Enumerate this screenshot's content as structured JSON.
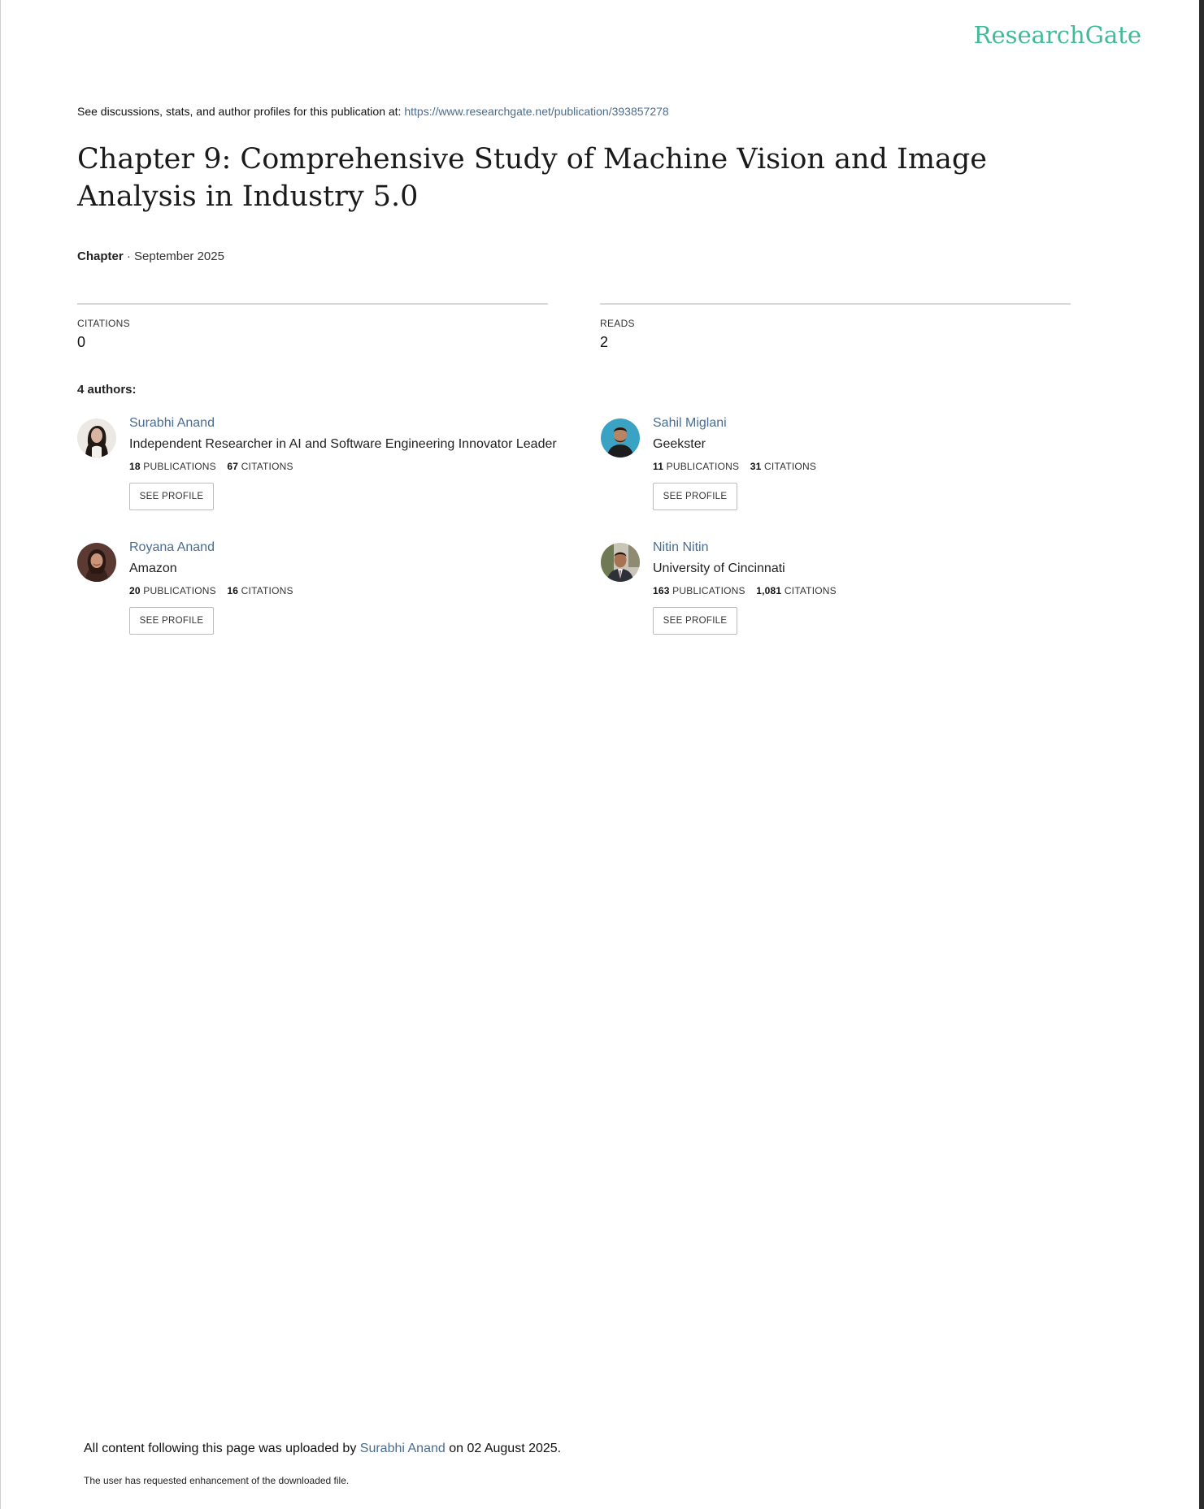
{
  "brand": {
    "logo_text": "ResearchGate",
    "logo_color": "#40ba9b",
    "link_color": "#4a6d8f"
  },
  "source": {
    "prefix": "See discussions, stats, and author profiles for this publication at:",
    "url": "https://www.researchgate.net/publication/393857278"
  },
  "publication": {
    "title": "Chapter 9: Comprehensive Study of Machine Vision and Image Analysis in Industry 5.0",
    "type": "Chapter",
    "separator": " · ",
    "date": "September 2025"
  },
  "stats": {
    "citations_label": "CITATIONS",
    "citations_value": "0",
    "reads_label": "READS",
    "reads_value": "2"
  },
  "authors_heading": "4 authors:",
  "authors": [
    {
      "name": "Surabhi Anand",
      "affiliation": "Independent Researcher in AI and Software Engineering Innovator Leader",
      "publications": "18",
      "citations": "67",
      "avatar": "portrait-woman-light-bg-icon"
    },
    {
      "name": "Sahil Miglani",
      "affiliation": "Geekster",
      "publications": "11",
      "citations": "31",
      "avatar": "portrait-man-blue-bg-icon"
    },
    {
      "name": "Royana Anand",
      "affiliation": "Amazon",
      "publications": "20",
      "citations": "16",
      "avatar": "portrait-woman-dark-bg-icon"
    },
    {
      "name": "Nitin Nitin",
      "affiliation": "University of Cincinnati",
      "publications": "163",
      "citations": "1,081",
      "avatar": "portrait-man-suit-icon"
    }
  ],
  "labels": {
    "publications": "PUBLICATIONS",
    "citations": "CITATIONS",
    "see_profile": "SEE PROFILE"
  },
  "footer": {
    "upload_prefix": "All content following this page was uploaded by",
    "uploader": "Surabhi Anand",
    "upload_suffix": "on 02 August 2025.",
    "note": "The user has requested enhancement of the downloaded file."
  }
}
